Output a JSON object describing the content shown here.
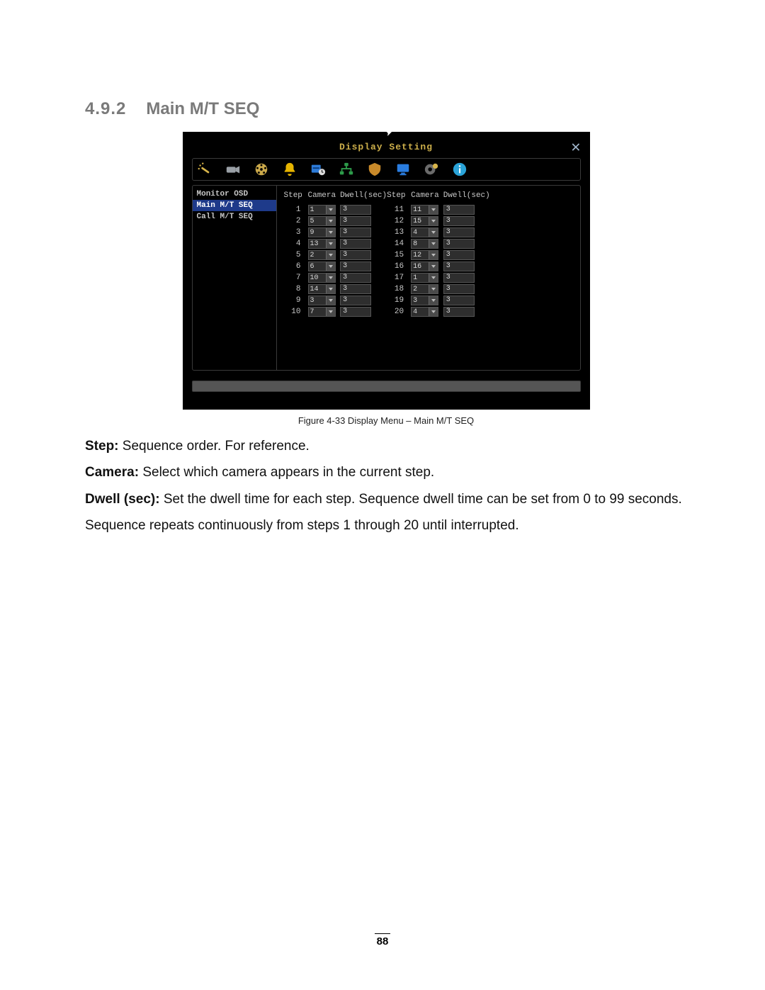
{
  "heading": {
    "number": "4.9.2",
    "title": "Main M/T SEQ"
  },
  "dvr": {
    "window_title": "Display Setting",
    "close_glyph": "✕",
    "icons": [
      "wand-icon",
      "camera-icon",
      "reel-icon",
      "bell-icon",
      "clock-icon",
      "network-icon",
      "badge-icon",
      "monitor-icon",
      "gear-icon",
      "info-icon"
    ],
    "sidebar": {
      "items": [
        {
          "label": "Monitor OSD",
          "selected": false
        },
        {
          "label": "Main M/T SEQ",
          "selected": true
        },
        {
          "label": "Call M/T SEQ",
          "selected": false
        }
      ]
    },
    "columns": {
      "step": "Step",
      "camera": "Camera",
      "dwell": "Dwell(sec)",
      "step2": "Step",
      "camera2": "Camera",
      "dwell2": "Dwell(sec)"
    },
    "rows_left": [
      {
        "step": "1",
        "camera": "1",
        "dwell": "3"
      },
      {
        "step": "2",
        "camera": "5",
        "dwell": "3"
      },
      {
        "step": "3",
        "camera": "9",
        "dwell": "3"
      },
      {
        "step": "4",
        "camera": "13",
        "dwell": "3"
      },
      {
        "step": "5",
        "camera": "2",
        "dwell": "3"
      },
      {
        "step": "6",
        "camera": "6",
        "dwell": "3"
      },
      {
        "step": "7",
        "camera": "10",
        "dwell": "3"
      },
      {
        "step": "8",
        "camera": "14",
        "dwell": "3"
      },
      {
        "step": "9",
        "camera": "3",
        "dwell": "3"
      },
      {
        "step": "10",
        "camera": "7",
        "dwell": "3"
      }
    ],
    "rows_right": [
      {
        "step": "11",
        "camera": "11",
        "dwell": "3"
      },
      {
        "step": "12",
        "camera": "15",
        "dwell": "3"
      },
      {
        "step": "13",
        "camera": "4",
        "dwell": "3"
      },
      {
        "step": "14",
        "camera": "8",
        "dwell": "3"
      },
      {
        "step": "15",
        "camera": "12",
        "dwell": "3"
      },
      {
        "step": "16",
        "camera": "16",
        "dwell": "3"
      },
      {
        "step": "17",
        "camera": "1",
        "dwell": "3"
      },
      {
        "step": "18",
        "camera": "2",
        "dwell": "3"
      },
      {
        "step": "19",
        "camera": "3",
        "dwell": "3"
      },
      {
        "step": "20",
        "camera": "4",
        "dwell": "3"
      }
    ]
  },
  "caption": "Figure 4-33  Display Menu – Main M/T SEQ",
  "body": {
    "p1_label": "Step:",
    "p1_text": " Sequence order. For reference.",
    "p2_label": "Camera:",
    "p2_text": " Select which camera appears in the current step.",
    "p3_label": "Dwell (sec):",
    "p3_text": " Set the dwell time for each step. Sequence dwell time can be set from 0 to 99 seconds.",
    "p4_text": "Sequence repeats continuously from steps 1 through 20 until interrupted."
  },
  "page_number": "88",
  "icon_colors": {
    "wand": "#d7b44a",
    "camera": "#9aa0a6",
    "reel": "#caa84a",
    "bell": "#e6b400",
    "clock": "#2d7bd8",
    "network": "#2d9b4a",
    "badge": "#c98a2a",
    "monitor": "#2a7de0",
    "gear": "#6b6b6b",
    "gear_star": "#d7b44a",
    "info": "#2aa3d8"
  }
}
